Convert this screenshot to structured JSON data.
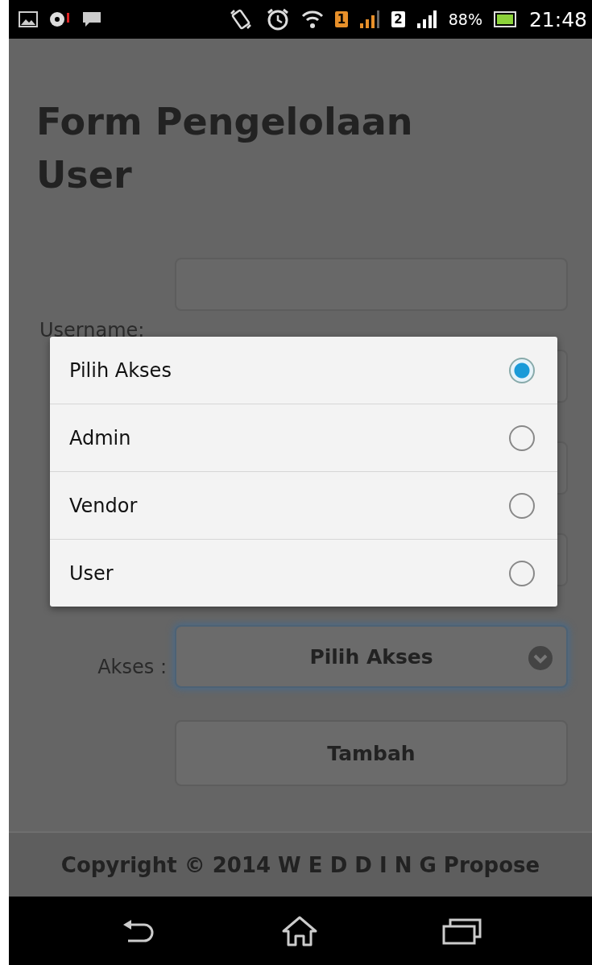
{
  "status_bar": {
    "sim_1": "1",
    "sim_2": "2",
    "battery": "88%",
    "time": "21:48"
  },
  "title": "Form Pengelolaan User",
  "form": {
    "fields": [
      {
        "kind": "text",
        "label": "Username:"
      },
      {
        "kind": "text"
      },
      {
        "kind": "text"
      },
      {
        "kind": "text"
      },
      {
        "kind": "select",
        "label": "Akses :",
        "value": "Pilih Akses",
        "focused": true
      }
    ],
    "submit": "Tambah"
  },
  "dialog": {
    "options": [
      {
        "label": "Pilih Akses",
        "selected": true
      },
      {
        "label": "Admin",
        "selected": false
      },
      {
        "label": "Vendor",
        "selected": false
      },
      {
        "label": "User",
        "selected": false
      }
    ]
  },
  "footer": "Copyright © 2014 W E D D I N G Propose"
}
